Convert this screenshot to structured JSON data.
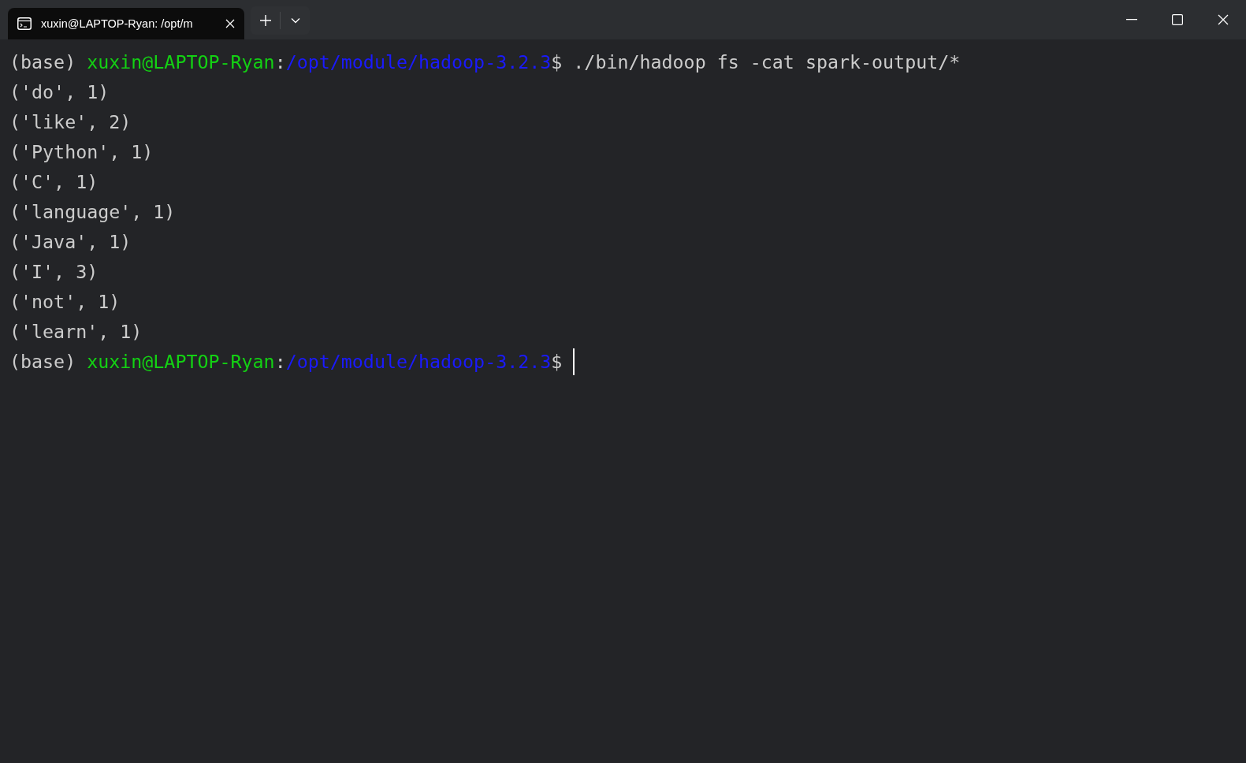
{
  "window": {
    "controls": [
      {
        "kind": "minimize"
      },
      {
        "kind": "maximize"
      },
      {
        "kind": "close"
      }
    ]
  },
  "tabs": [
    {
      "title": "xuxin@LAPTOP-Ryan: /opt/m",
      "selected": true
    }
  ],
  "terminal": {
    "lines": [
      [
        {
          "kind": "plain",
          "text": "(base) "
        },
        {
          "kind": "user",
          "text": "xuxin@LAPTOP-Ryan"
        },
        {
          "kind": "plain",
          "text": ":"
        },
        {
          "kind": "path",
          "text": "/opt/module/hadoop-3.2.3"
        },
        {
          "kind": "plain",
          "text": "$ ./bin/hadoop fs -cat spark-output/*"
        }
      ],
      [
        {
          "kind": "plain",
          "text": "('do', 1)"
        }
      ],
      [
        {
          "kind": "plain",
          "text": "('like', 2)"
        }
      ],
      [
        {
          "kind": "plain",
          "text": "('Python', 1)"
        }
      ],
      [
        {
          "kind": "plain",
          "text": "('C', 1)"
        }
      ],
      [
        {
          "kind": "plain",
          "text": "('language', 1)"
        }
      ],
      [
        {
          "kind": "plain",
          "text": "('Java', 1)"
        }
      ],
      [
        {
          "kind": "plain",
          "text": "('I', 3)"
        }
      ],
      [
        {
          "kind": "plain",
          "text": "('not', 1)"
        }
      ],
      [
        {
          "kind": "plain",
          "text": "('learn', 1)"
        }
      ],
      [
        {
          "kind": "plain",
          "text": "(base) "
        },
        {
          "kind": "user",
          "text": "xuxin@LAPTOP-Ryan"
        },
        {
          "kind": "plain",
          "text": ":"
        },
        {
          "kind": "path",
          "text": "/opt/module/hadoop-3.2.3"
        },
        {
          "kind": "plain",
          "text": "$ "
        },
        {
          "kind": "cursor"
        }
      ]
    ]
  }
}
